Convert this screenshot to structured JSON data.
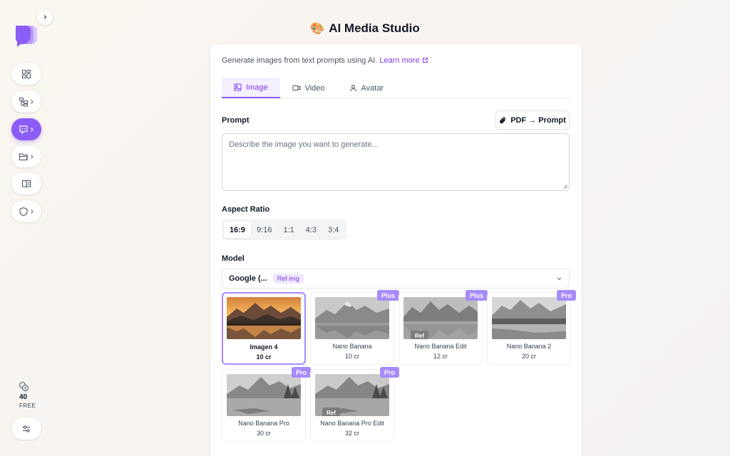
{
  "header": {
    "title": "AI Media Studio",
    "title_emoji": "🎨"
  },
  "sidebar": {
    "items": [
      {
        "icon": "dashboard-icon"
      },
      {
        "icon": "hierarchy-icon"
      },
      {
        "icon": "chat-icon",
        "active": true
      },
      {
        "icon": "folder-icon"
      },
      {
        "icon": "book-icon"
      },
      {
        "icon": "shield-icon"
      }
    ],
    "credits": {
      "count": "40",
      "label": "FREE"
    }
  },
  "intro": {
    "text": "Generate images from text prompts using AI.",
    "link": "Learn more"
  },
  "tabs": [
    {
      "label": "Image",
      "icon": "image-icon",
      "active": true
    },
    {
      "label": "Video",
      "icon": "video-icon"
    },
    {
      "label": "Avatar",
      "icon": "user-icon"
    }
  ],
  "prompt": {
    "label": "Prompt",
    "pdf_button": "PDF → Prompt",
    "placeholder": "Describe the image you want to generate..."
  },
  "aspect_ratio": {
    "label": "Aspect Ratio",
    "options": [
      "16:9",
      "9:16",
      "1:1",
      "4:3",
      "3:4"
    ],
    "selected": "16:9"
  },
  "model": {
    "label": "Model",
    "provider": "Google (...",
    "provider_badge": "Ref img",
    "cards": [
      {
        "name": "Imagen 4",
        "cost": "10 cr",
        "selected": true,
        "tier": "",
        "ref": false
      },
      {
        "name": "Nano Banana",
        "cost": "10 cr",
        "tier": "Plus",
        "ref": false
      },
      {
        "name": "Nano Banana Edit",
        "cost": "12 cr",
        "tier": "Plus",
        "ref": true,
        "ref_label": "Ref"
      },
      {
        "name": "Nano Banana 2",
        "cost": "20 cr",
        "tier": "Pro",
        "ref": false
      },
      {
        "name": "Nano Banana Pro",
        "cost": "30 cr",
        "tier": "Pro",
        "ref": false
      },
      {
        "name": "Nano Banana Pro Edit",
        "cost": "32 cr",
        "tier": "Pro",
        "ref": true,
        "ref_label": "Ref"
      }
    ]
  },
  "colors": {
    "accent": "#8b5cf6",
    "accent_light": "#a78bfa",
    "accent_text": "#7c3aed"
  }
}
